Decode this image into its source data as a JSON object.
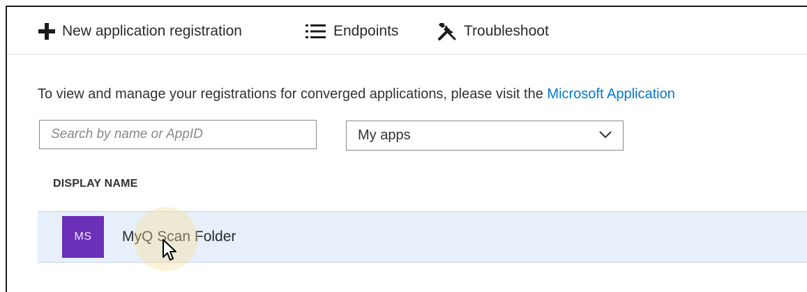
{
  "toolbar": {
    "new_registration_label": "New application registration",
    "endpoints_label": "Endpoints",
    "troubleshoot_label": "Troubleshoot"
  },
  "info": {
    "text": "To view and manage your registrations for converged applications, please visit the ",
    "link_text": "Microsoft Application"
  },
  "search": {
    "placeholder": "Search by name or AppID",
    "value": ""
  },
  "filter": {
    "selected": "My apps"
  },
  "table": {
    "column_header": "DISPLAY NAME",
    "rows": [
      {
        "avatar_initials": "MS",
        "avatar_color": "#6b2fb8",
        "name": "MyQ Scan Folder"
      }
    ]
  },
  "colors": {
    "accent_link": "#0078d4",
    "row_selected_bg": "#e7f0fa"
  },
  "icons": {
    "new": "plus-icon",
    "endpoints": "list-icon",
    "troubleshoot": "wrench-screwdriver-icon",
    "dropdown": "chevron-down-icon",
    "pointer": "mouse-cursor-icon"
  }
}
